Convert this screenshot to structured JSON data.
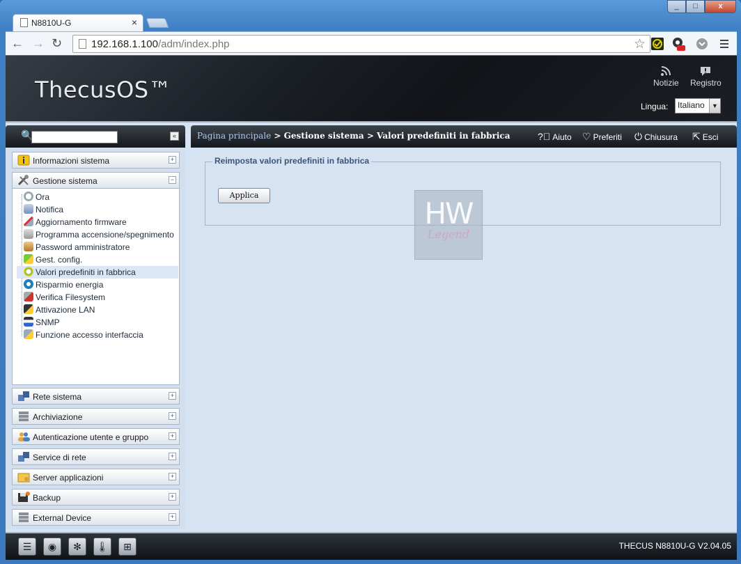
{
  "browser": {
    "tab_title": "N8810U-G",
    "tab_close": "×",
    "url_host": "192.168.1.100",
    "url_path": "/adm/index.php",
    "back": "←",
    "forward": "→",
    "reload": "↻",
    "bookmark": "☆"
  },
  "window_controls": {
    "minimize": "_",
    "maximize": "□",
    "close": "x"
  },
  "header": {
    "logo": "ThecusOS™",
    "news_label": "Notizie",
    "log_label": "Registro",
    "language_label": "Lingua:",
    "language_value": "Italiano"
  },
  "sidebar": {
    "search_placeholder": "",
    "groups": [
      {
        "label": "Informazioni sistema",
        "toggle": "+"
      },
      {
        "label": "Gestione sistema",
        "toggle": "−"
      },
      {
        "label": "Rete sistema",
        "toggle": "+"
      },
      {
        "label": "Archiviazione",
        "toggle": "+"
      },
      {
        "label": "Autenticazione utente e gruppo",
        "toggle": "+"
      },
      {
        "label": "Service di rete",
        "toggle": "+"
      },
      {
        "label": "Server applicazioni",
        "toggle": "+"
      },
      {
        "label": "Backup",
        "toggle": "+"
      },
      {
        "label": "External Device",
        "toggle": "+"
      }
    ],
    "items": [
      "Ora",
      "Notifica",
      "Aggiornamento firmware",
      "Programma accensione/spegnimento",
      "Password amministratore",
      "Gest. config.",
      "Valori predefiniti in fabbrica",
      "Risparmio energia",
      "Verifica Filesystem",
      "Attivazione LAN",
      "SNMP",
      "Funzione accesso interfaccia"
    ]
  },
  "breadcrumb": {
    "home": "Pagina principale",
    "path": " > Gestione sistema > Valori predefiniti in fabbrica"
  },
  "topbar": {
    "help": "Aiuto",
    "favorites": "Preferiti",
    "shutdown": "Chiusura",
    "logout": "Esci"
  },
  "content": {
    "legend": "Reimposta valori predefiniti in fabbrica",
    "apply_label": "Applica"
  },
  "watermark": {
    "big": "HW",
    "small": "Legend"
  },
  "footer": {
    "version": "THECUS N8810U-G V2.04.05"
  }
}
